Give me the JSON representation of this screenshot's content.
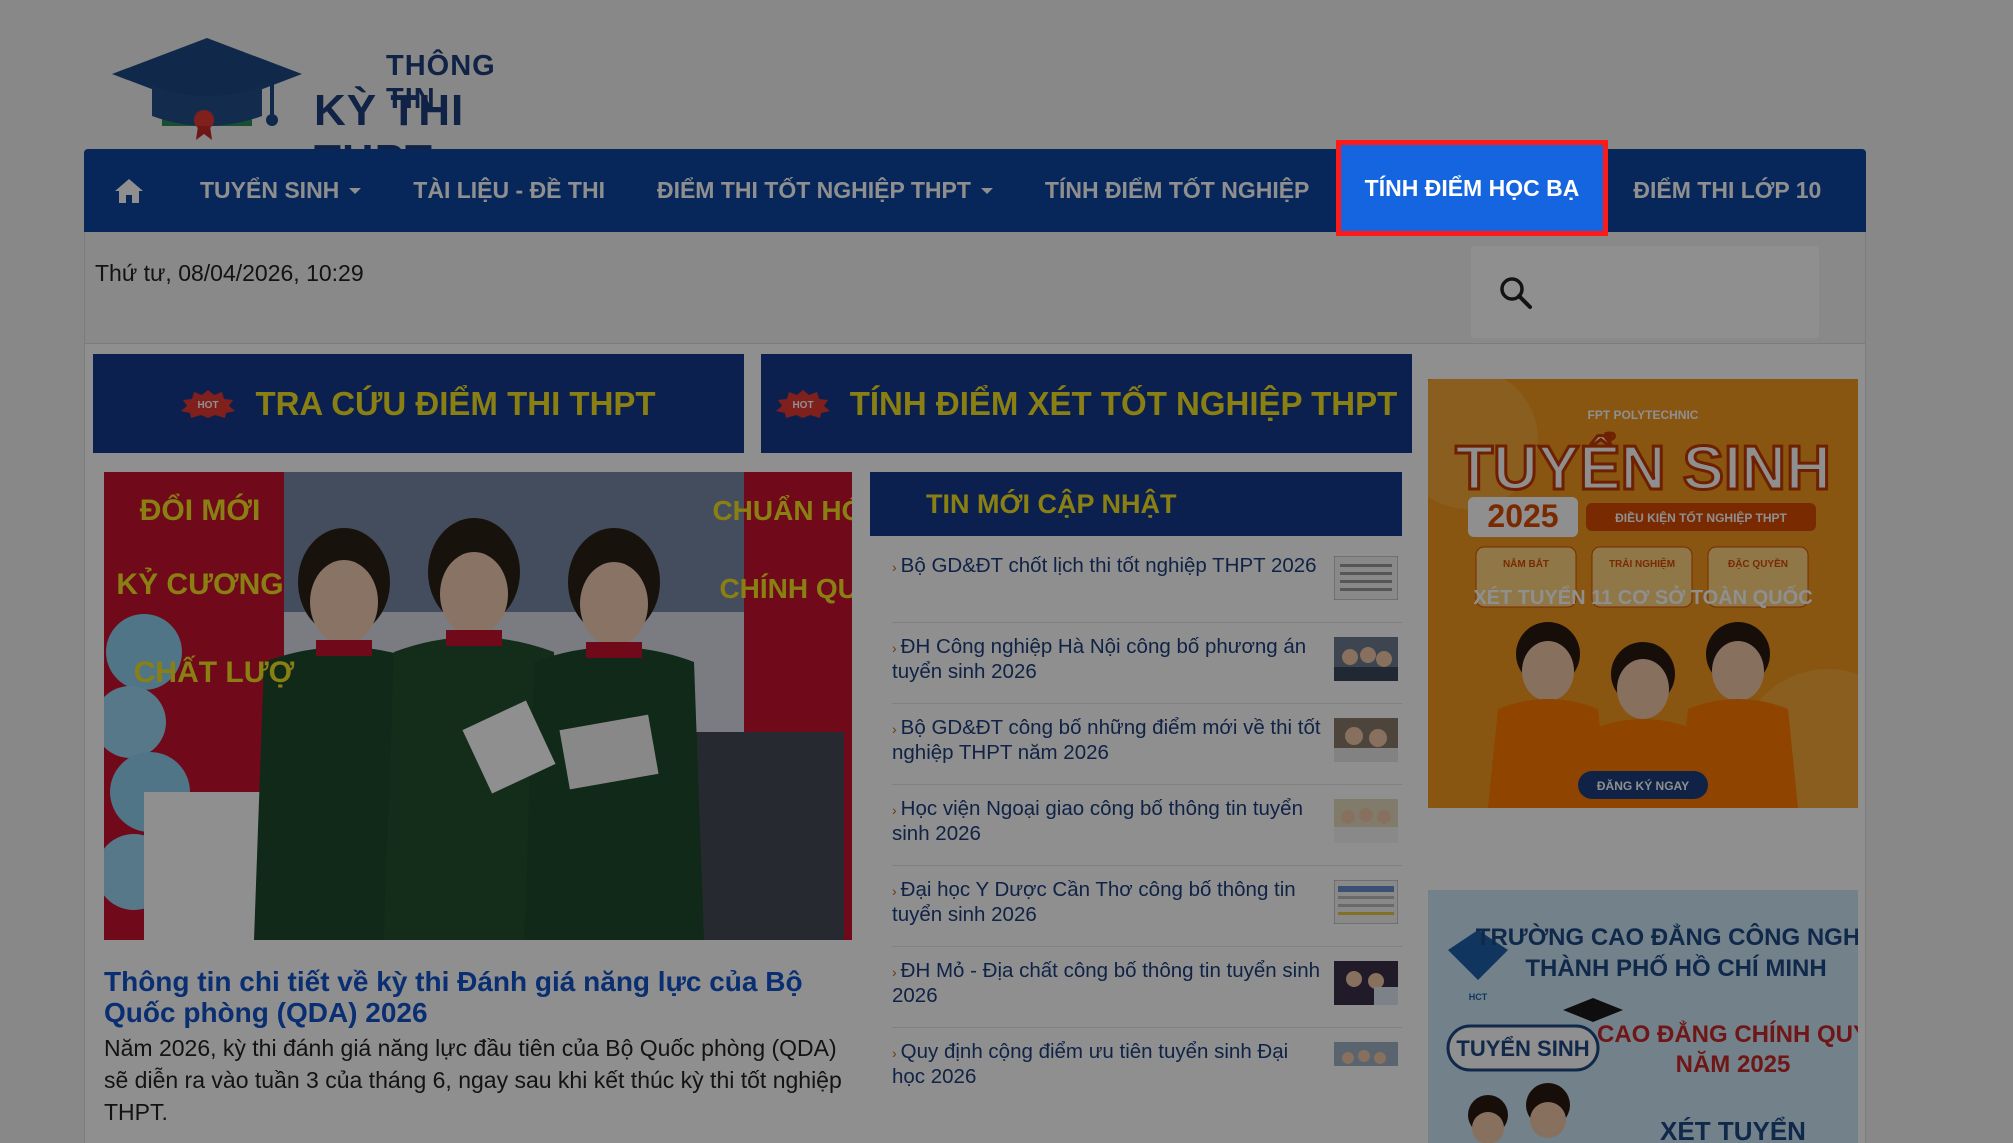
{
  "logo": {
    "small": "THÔNG TIN",
    "big": "KỲ THI THPT"
  },
  "nav": {
    "items": [
      {
        "label": "TUYỂN SINH",
        "dropdown": true
      },
      {
        "label": "TÀI LIỆU - ĐỀ THI",
        "dropdown": false
      },
      {
        "label": "ĐIỂM THI TỐT NGHIỆP THPT",
        "dropdown": true
      },
      {
        "label": "TÍNH ĐIỂM TỐT NGHIỆP",
        "dropdown": false
      },
      {
        "label": "TÍNH ĐIỂM HỌC BẠ",
        "dropdown": false,
        "active": true
      },
      {
        "label": "ĐIỂM THI LỚP 10",
        "dropdown": false
      }
    ]
  },
  "datetime": "Thứ tư, 08/04/2026, 10:29",
  "buttons": {
    "lookup": "TRA CỨU ĐIỂM THI THPT",
    "calc": "TÍNH ĐIỂM XÉT TỐT NGHIỆP THPT",
    "badge": "HOT"
  },
  "featured": {
    "title": "Thông tin chi tiết về kỳ thi Đánh giá năng lực của Bộ Quốc phòng (QDA) 2026",
    "desc": "Năm 2026, kỳ thi đánh giá năng lực đầu tiên của Bộ Quốc phòng (QDA) sẽ diễn ra vào tuần 3 của tháng 6, ngay sau khi kết thúc kỳ thi tốt nghiệp THPT.",
    "banner_left": [
      "ĐỔI MỚI",
      "KỶ CƯƠNG",
      "CHẤT LƯỢ"
    ],
    "banner_right": [
      "CHUẨN HÓA",
      "CHÍNH QUY"
    ]
  },
  "news": {
    "heading": "TIN MỚI CẬP NHẬT",
    "items": [
      "Bộ GD&ĐT chốt lịch thi tốt nghiệp THPT 2026",
      "ĐH Công nghiệp Hà Nội công bố phương án tuyển sinh 2026",
      "Bộ GD&ĐT công bố những điểm mới về thi tốt nghiệp THPT năm 2026",
      "Học viện Ngoại giao công bố thông tin tuyển sinh 2026",
      "Đại học Y Dược Cần Thơ công bố thông tin tuyển sinh 2026",
      "ĐH Mỏ - Địa chất công bố thông tin tuyển sinh 2026",
      "Quy định cộng điểm ưu tiên tuyển sinh Đại học 2026"
    ]
  },
  "ad1": {
    "brand": "FPT POLYTECHNIC",
    "title": "TUYỂN SINH",
    "year": "2025",
    "condition": "ĐIỀU KIỆN TỐT NGHIỆP THPT",
    "tags": [
      "NẮM BẮT",
      "TRẢI NGHIỆM",
      "ĐẶC QUYỀN"
    ],
    "headline": "XÉT TUYỂN 11 CƠ SỞ TOÀN QUỐC",
    "cta": "ĐĂNG KÝ NGAY"
  },
  "ad2": {
    "line1": "TRƯỜNG CAO ĐẲNG CÔNG NGHỆ",
    "line2": "THÀNH PHỐ HỒ CHÍ MINH",
    "tag": "TUYỂN SINH",
    "headline1": "CAO ĐẲNG CHÍNH QUY",
    "headline2": "NĂM 2025",
    "footer": "XÉT TUYỂN",
    "logo_text": "HCT"
  },
  "colors": {
    "nav_bg": "#0d47a1",
    "active_bg": "#1565e0",
    "highlight": "#ff1a1a",
    "btn_bg": "#143a8b",
    "btn_text": "#f5e322"
  }
}
